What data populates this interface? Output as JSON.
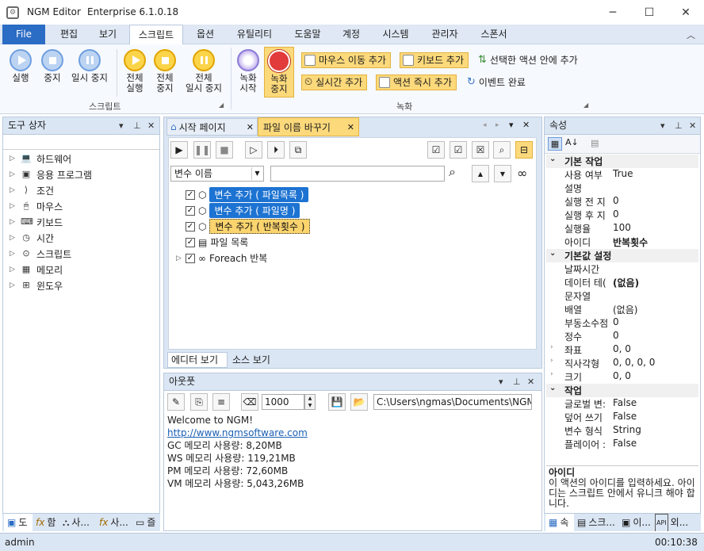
{
  "window": {
    "title": "NGM Editor",
    "version": "Enterprise 6.1.0.18"
  },
  "menu": {
    "items": [
      "File",
      "편집",
      "보기",
      "스크립트",
      "옵션",
      "유틸리티",
      "도움말",
      "계정",
      "시스템",
      "관리자",
      "스폰서"
    ]
  },
  "ribbon": {
    "script_group": {
      "label": "스크립트",
      "run": "실행",
      "stop": "중지",
      "pause": "일시 중지",
      "run_all_1": "전체",
      "run_all_2": "실행",
      "stop_all_1": "전체",
      "stop_all_2": "중지",
      "pause_all_1": "전체",
      "pause_all_2": "일시 중지"
    },
    "record_group": {
      "label": "녹화",
      "record_start_1": "녹화",
      "record_start_2": "시작",
      "record_stop_1": "녹화",
      "record_stop_2": "중지",
      "add_mouse_move": "마우스 이동 추가",
      "add_keyboard": "키보드 추가",
      "add_in_selected": "선택한 액션 안에 추가",
      "add_realtime": "실시간 추가",
      "add_action_now": "액션 즉시 추가",
      "event_done": "이벤트 완료"
    }
  },
  "toolbox": {
    "title": "도구 상자",
    "items": [
      {
        "label": "하드웨어",
        "icon": "laptop-icon"
      },
      {
        "label": "응용 프로그램",
        "icon": "app-icon"
      },
      {
        "label": "조건",
        "icon": "condition-icon"
      },
      {
        "label": "마우스",
        "icon": "mouse-icon"
      },
      {
        "label": "키보드",
        "icon": "keyboard-icon"
      },
      {
        "label": "시간",
        "icon": "clock-icon"
      },
      {
        "label": "스크립트",
        "icon": "script-icon"
      },
      {
        "label": "메모리",
        "icon": "memory-icon"
      },
      {
        "label": "윈도우",
        "icon": "windows-icon"
      }
    ],
    "bottom_tabs": [
      "도",
      "함",
      "사...",
      "사...",
      "즐"
    ]
  },
  "editor": {
    "tabs": [
      "시작 페이지",
      "파일 이름 바꾸기"
    ],
    "var_select": "변수 이름",
    "items": [
      {
        "label": "변수 추가 ( 파일목록 )",
        "style": "selected"
      },
      {
        "label": "변수 추가 ( 파일명 )",
        "style": "selected"
      },
      {
        "label": "변수 추가 ( 반복횟수 )",
        "style": "focused"
      },
      {
        "label": "파일 목록",
        "style": "normal"
      },
      {
        "label": "Foreach 반복",
        "style": "normal"
      }
    ],
    "bottom_tabs": [
      "에디터 보기",
      "소스 보기"
    ]
  },
  "output": {
    "title": "아웃풋",
    "count": "1000",
    "path": "C:\\Users\\ngmas\\Documents\\NGM6\\",
    "lines": [
      "Welcome to NGM!",
      "http://www.ngmsoftware.com",
      "GC 메모리 사용량: 8,20MB",
      "WS 메모리 사용량: 119,21MB",
      "PM 메모리 사용량: 72,60MB",
      "VM 메모리 사용량: 5,043,26MB"
    ]
  },
  "properties": {
    "title": "속성",
    "categories": [
      {
        "name": "기본 작업",
        "rows": [
          {
            "k": "사용 여부",
            "v": "True"
          },
          {
            "k": "설명",
            "v": ""
          },
          {
            "k": "실행 전 지",
            "v": "0"
          },
          {
            "k": "실행 후 지",
            "v": "0"
          },
          {
            "k": "실행율",
            "v": "100"
          },
          {
            "k": "아이디",
            "v": "반복횟수",
            "bold": true
          }
        ]
      },
      {
        "name": "기본값 설정",
        "rows": [
          {
            "k": "날짜시간",
            "v": ""
          },
          {
            "k": "데이터 테(",
            "v": "(없음)",
            "bold": true
          },
          {
            "k": "문자열",
            "v": ""
          },
          {
            "k": "배열",
            "v": "(없음)"
          },
          {
            "k": "부동소수점",
            "v": "0"
          },
          {
            "k": "정수",
            "v": "0"
          },
          {
            "k": "좌표",
            "v": "0, 0",
            "expand": true
          },
          {
            "k": "직사각형",
            "v": "0, 0, 0, 0",
            "expand": true
          },
          {
            "k": "크기",
            "v": "0, 0",
            "expand": true
          }
        ]
      },
      {
        "name": "작업",
        "rows": [
          {
            "k": "글로벌 변:",
            "v": "False"
          },
          {
            "k": "덮어 쓰기",
            "v": "False"
          },
          {
            "k": "변수 형식",
            "v": "String"
          },
          {
            "k": "플레이어 :",
            "v": "False"
          }
        ]
      }
    ],
    "desc_title": "아이디",
    "desc_text": "이 액션의 아이디를 입력하세요. 아이디는 스크립트 안에서 유니크 해야 합니다.",
    "bottom_tabs": [
      "속",
      "스크...",
      "이...",
      "외..."
    ]
  },
  "status": {
    "user": "admin",
    "time": "00:10:38"
  }
}
